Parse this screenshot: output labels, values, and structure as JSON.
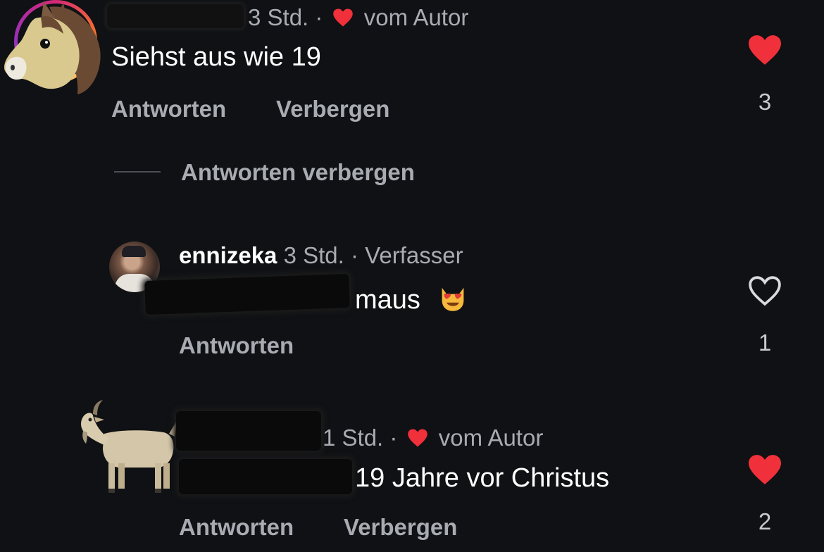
{
  "comments": [
    {
      "time": "3 Std.",
      "separator": "·",
      "author_badge": "vom Autor",
      "text": "Siehst aus wie 19",
      "reply_label": "Antworten",
      "hide_label": "Verbergen",
      "like_count": "3",
      "liked": true,
      "avatar": "horse-emoji-avatar"
    },
    {
      "time": "1 Std.",
      "separator": "·",
      "author_badge": "vom Autor",
      "text": "19 Jahre vor Christus",
      "reply_label": "Antworten",
      "hide_label": "Verbergen",
      "like_count": "2",
      "liked": true,
      "avatar": "goat-emoji-avatar"
    }
  ],
  "hide_replies_label": "Antworten verbergen",
  "reply": {
    "username": "ennizeka",
    "time": "3 Std.",
    "separator": "·",
    "author_badge": "Verfasser",
    "text": "maus",
    "emoji": "smiling-cat-heart-eyes-icon",
    "reply_label": "Antworten",
    "like_count": "1",
    "liked": false
  },
  "colors": {
    "background": "#0f1114",
    "heart_red": "#f0303a",
    "secondary_text": "#a8abb2"
  }
}
